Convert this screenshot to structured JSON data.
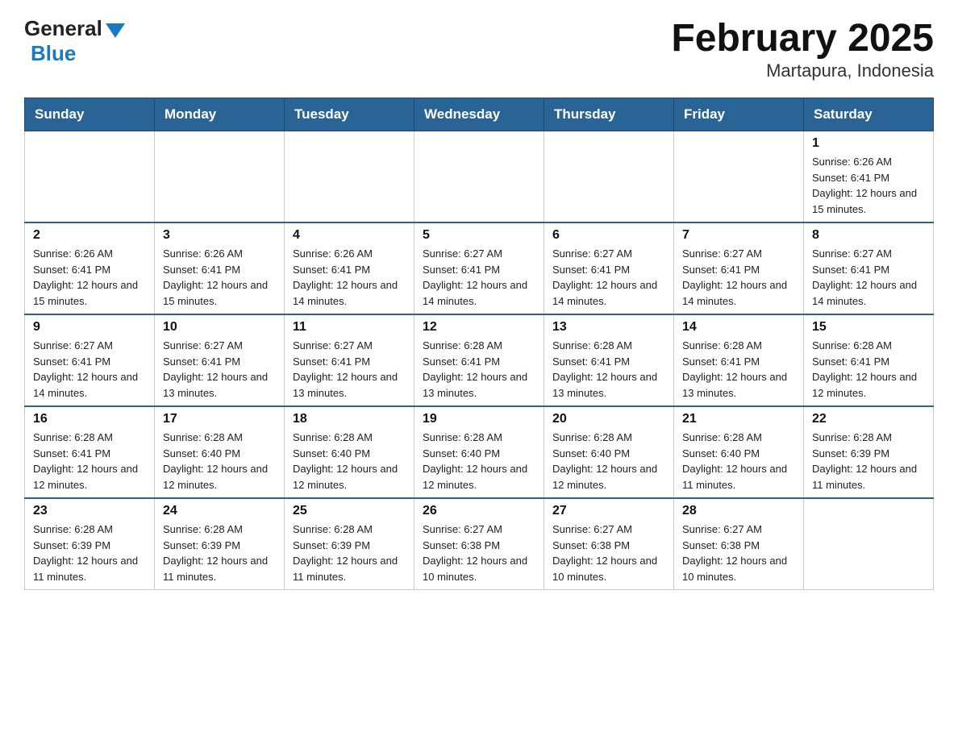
{
  "header": {
    "logo_general": "General",
    "logo_blue": "Blue",
    "month_title": "February 2025",
    "location": "Martapura, Indonesia"
  },
  "weekdays": [
    "Sunday",
    "Monday",
    "Tuesday",
    "Wednesday",
    "Thursday",
    "Friday",
    "Saturday"
  ],
  "weeks": [
    [
      {
        "day": "",
        "sunrise": "",
        "sunset": "",
        "daylight": ""
      },
      {
        "day": "",
        "sunrise": "",
        "sunset": "",
        "daylight": ""
      },
      {
        "day": "",
        "sunrise": "",
        "sunset": "",
        "daylight": ""
      },
      {
        "day": "",
        "sunrise": "",
        "sunset": "",
        "daylight": ""
      },
      {
        "day": "",
        "sunrise": "",
        "sunset": "",
        "daylight": ""
      },
      {
        "day": "",
        "sunrise": "",
        "sunset": "",
        "daylight": ""
      },
      {
        "day": "1",
        "sunrise": "Sunrise: 6:26 AM",
        "sunset": "Sunset: 6:41 PM",
        "daylight": "Daylight: 12 hours and 15 minutes."
      }
    ],
    [
      {
        "day": "2",
        "sunrise": "Sunrise: 6:26 AM",
        "sunset": "Sunset: 6:41 PM",
        "daylight": "Daylight: 12 hours and 15 minutes."
      },
      {
        "day": "3",
        "sunrise": "Sunrise: 6:26 AM",
        "sunset": "Sunset: 6:41 PM",
        "daylight": "Daylight: 12 hours and 15 minutes."
      },
      {
        "day": "4",
        "sunrise": "Sunrise: 6:26 AM",
        "sunset": "Sunset: 6:41 PM",
        "daylight": "Daylight: 12 hours and 14 minutes."
      },
      {
        "day": "5",
        "sunrise": "Sunrise: 6:27 AM",
        "sunset": "Sunset: 6:41 PM",
        "daylight": "Daylight: 12 hours and 14 minutes."
      },
      {
        "day": "6",
        "sunrise": "Sunrise: 6:27 AM",
        "sunset": "Sunset: 6:41 PM",
        "daylight": "Daylight: 12 hours and 14 minutes."
      },
      {
        "day": "7",
        "sunrise": "Sunrise: 6:27 AM",
        "sunset": "Sunset: 6:41 PM",
        "daylight": "Daylight: 12 hours and 14 minutes."
      },
      {
        "day": "8",
        "sunrise": "Sunrise: 6:27 AM",
        "sunset": "Sunset: 6:41 PM",
        "daylight": "Daylight: 12 hours and 14 minutes."
      }
    ],
    [
      {
        "day": "9",
        "sunrise": "Sunrise: 6:27 AM",
        "sunset": "Sunset: 6:41 PM",
        "daylight": "Daylight: 12 hours and 14 minutes."
      },
      {
        "day": "10",
        "sunrise": "Sunrise: 6:27 AM",
        "sunset": "Sunset: 6:41 PM",
        "daylight": "Daylight: 12 hours and 13 minutes."
      },
      {
        "day": "11",
        "sunrise": "Sunrise: 6:27 AM",
        "sunset": "Sunset: 6:41 PM",
        "daylight": "Daylight: 12 hours and 13 minutes."
      },
      {
        "day": "12",
        "sunrise": "Sunrise: 6:28 AM",
        "sunset": "Sunset: 6:41 PM",
        "daylight": "Daylight: 12 hours and 13 minutes."
      },
      {
        "day": "13",
        "sunrise": "Sunrise: 6:28 AM",
        "sunset": "Sunset: 6:41 PM",
        "daylight": "Daylight: 12 hours and 13 minutes."
      },
      {
        "day": "14",
        "sunrise": "Sunrise: 6:28 AM",
        "sunset": "Sunset: 6:41 PM",
        "daylight": "Daylight: 12 hours and 13 minutes."
      },
      {
        "day": "15",
        "sunrise": "Sunrise: 6:28 AM",
        "sunset": "Sunset: 6:41 PM",
        "daylight": "Daylight: 12 hours and 12 minutes."
      }
    ],
    [
      {
        "day": "16",
        "sunrise": "Sunrise: 6:28 AM",
        "sunset": "Sunset: 6:41 PM",
        "daylight": "Daylight: 12 hours and 12 minutes."
      },
      {
        "day": "17",
        "sunrise": "Sunrise: 6:28 AM",
        "sunset": "Sunset: 6:40 PM",
        "daylight": "Daylight: 12 hours and 12 minutes."
      },
      {
        "day": "18",
        "sunrise": "Sunrise: 6:28 AM",
        "sunset": "Sunset: 6:40 PM",
        "daylight": "Daylight: 12 hours and 12 minutes."
      },
      {
        "day": "19",
        "sunrise": "Sunrise: 6:28 AM",
        "sunset": "Sunset: 6:40 PM",
        "daylight": "Daylight: 12 hours and 12 minutes."
      },
      {
        "day": "20",
        "sunrise": "Sunrise: 6:28 AM",
        "sunset": "Sunset: 6:40 PM",
        "daylight": "Daylight: 12 hours and 12 minutes."
      },
      {
        "day": "21",
        "sunrise": "Sunrise: 6:28 AM",
        "sunset": "Sunset: 6:40 PM",
        "daylight": "Daylight: 12 hours and 11 minutes."
      },
      {
        "day": "22",
        "sunrise": "Sunrise: 6:28 AM",
        "sunset": "Sunset: 6:39 PM",
        "daylight": "Daylight: 12 hours and 11 minutes."
      }
    ],
    [
      {
        "day": "23",
        "sunrise": "Sunrise: 6:28 AM",
        "sunset": "Sunset: 6:39 PM",
        "daylight": "Daylight: 12 hours and 11 minutes."
      },
      {
        "day": "24",
        "sunrise": "Sunrise: 6:28 AM",
        "sunset": "Sunset: 6:39 PM",
        "daylight": "Daylight: 12 hours and 11 minutes."
      },
      {
        "day": "25",
        "sunrise": "Sunrise: 6:28 AM",
        "sunset": "Sunset: 6:39 PM",
        "daylight": "Daylight: 12 hours and 11 minutes."
      },
      {
        "day": "26",
        "sunrise": "Sunrise: 6:27 AM",
        "sunset": "Sunset: 6:38 PM",
        "daylight": "Daylight: 12 hours and 10 minutes."
      },
      {
        "day": "27",
        "sunrise": "Sunrise: 6:27 AM",
        "sunset": "Sunset: 6:38 PM",
        "daylight": "Daylight: 12 hours and 10 minutes."
      },
      {
        "day": "28",
        "sunrise": "Sunrise: 6:27 AM",
        "sunset": "Sunset: 6:38 PM",
        "daylight": "Daylight: 12 hours and 10 minutes."
      },
      {
        "day": "",
        "sunrise": "",
        "sunset": "",
        "daylight": ""
      }
    ]
  ]
}
